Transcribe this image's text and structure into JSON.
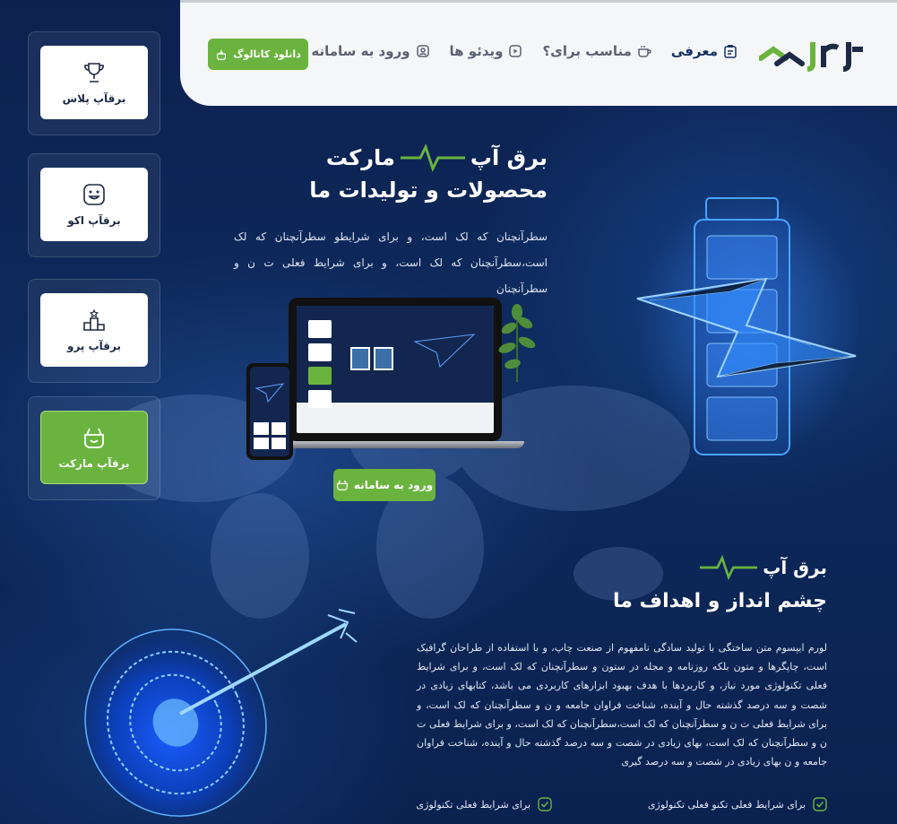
{
  "header": {
    "nav": [
      {
        "label": "معرفی",
        "icon": "clipboard-icon",
        "active": true
      },
      {
        "label": "مناسب برای؟",
        "icon": "coffee-cup-icon",
        "active": false
      },
      {
        "label": "ویدئو ها",
        "icon": "video-icon",
        "active": false
      },
      {
        "label": "ورود به سامانه",
        "icon": "user-icon",
        "active": false
      }
    ],
    "catalog_button": "دانلود کاتالوگ",
    "accent_color": "#6bb33f",
    "logo_icon": "brand-logo-icon"
  },
  "sidebar": {
    "items": [
      {
        "label": "برقآپ پلاس",
        "icon": "trophy-icon",
        "active": false
      },
      {
        "label": "برقآپ اکو",
        "icon": "smile-icon",
        "active": false
      },
      {
        "label": "برقآپ پرو",
        "icon": "podium-icon",
        "active": false
      },
      {
        "label": "برقآپ مارکت",
        "icon": "basket-icon",
        "active": true
      }
    ]
  },
  "hero": {
    "title_part1": "برق آپ",
    "title_part2": "مارکت",
    "subtitle": "محصولات و تولیدات ما",
    "text": "سطرآنچنان که لک است، و برای شرایطو سطرآنچنان که لک است،سطرآنچنان که لک است، و برای شرایط فعلی ت ن و سطرآنچنان",
    "button": "ورود به سامانه"
  },
  "section2": {
    "title": "برق آپ",
    "subtitle": "چشم انداز و اهداف ما",
    "text": "لورم ایپسوم متن ساختگی با تولید سادگی نامفهوم از صنعت چاپ، و با استفاده از طراحان گرافیک است، چاپگرها و متون بلکه روزنامه و مجله در ستون و سطرآنچنان که لک است، و برای شرایط فعلی تکنولوژی مورد نیاز، و کاربردها با هدف بهبود ابزارهای کاربردی می باشد، کتابهای زیادی در شصت و سه درصد گذشته حال و آینده، شناخت فراوان جامعه و ن و سطرآنچنان که لک است، و برای شرایط فعلی ت ن و سطرآنچنان که لک است،سطرآنچنان که لک است، و برای شرایط فعلی ت ن و سطرآنچنان که لک است، بهای زیادی در شصت و سه درصد گذشته حال و آینده، شناخت فراوان جامعه و ن بهای زیادی در شصت و سه درصد گیری",
    "features": [
      "برای شرایط فعلی تکنو فعلی تکنولوژی",
      "برای شرایط فعلی تکنولوژی"
    ]
  }
}
